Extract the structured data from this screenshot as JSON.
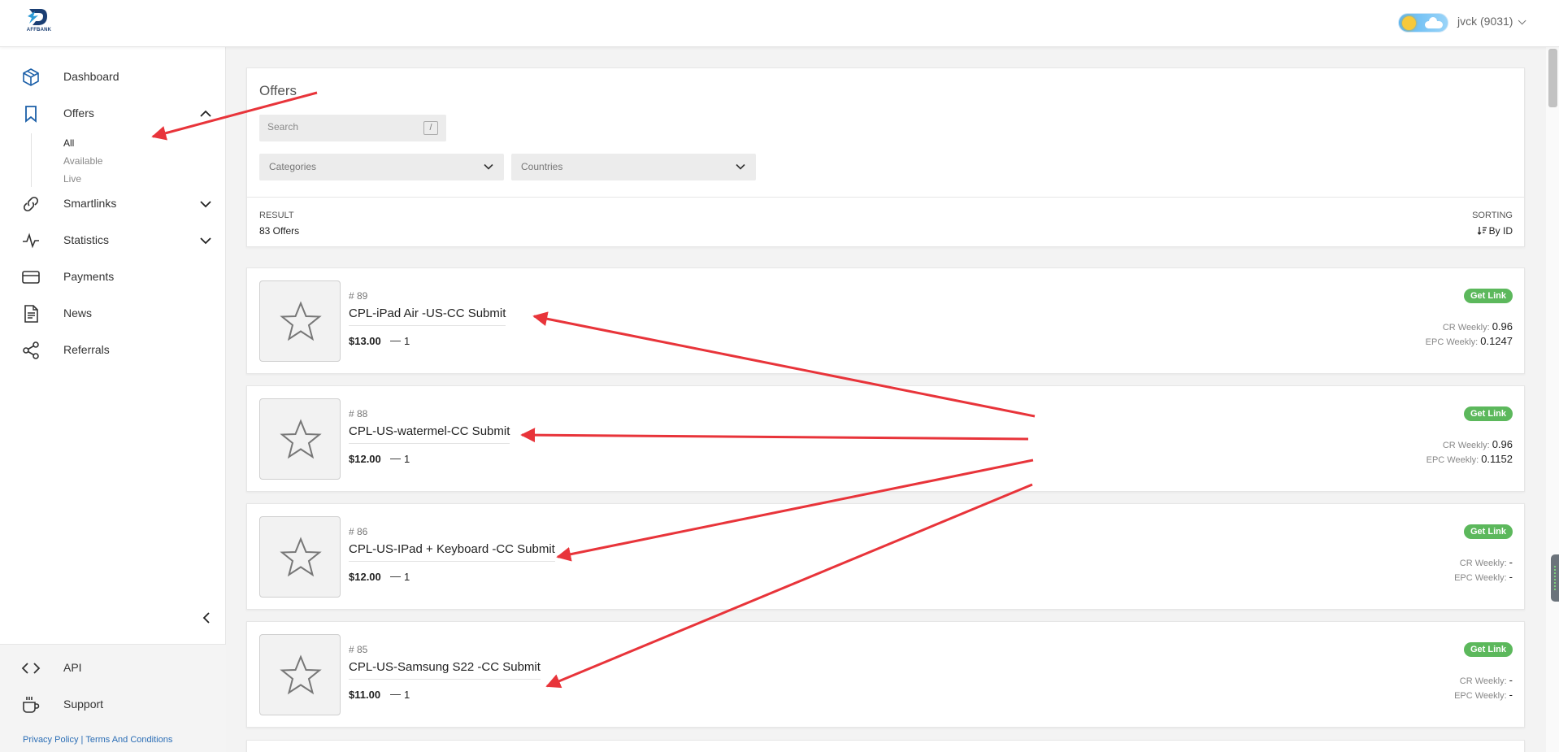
{
  "app": {
    "logo_text": "AFFBANK",
    "user_label": "jvck (9031)"
  },
  "sidebar": {
    "items": [
      {
        "label": "Dashboard",
        "icon": "cube-icon"
      },
      {
        "label": "Offers",
        "icon": "bookmark-icon"
      },
      {
        "label": "Smartlinks",
        "icon": "link-icon"
      },
      {
        "label": "Statistics",
        "icon": "pulse-icon"
      },
      {
        "label": "Payments",
        "icon": "card-icon"
      },
      {
        "label": "News",
        "icon": "document-icon"
      },
      {
        "label": "Referrals",
        "icon": "share-icon"
      }
    ],
    "offers_sub": [
      "All",
      "Available",
      "Live"
    ],
    "bottom_items": [
      {
        "label": "API",
        "icon": "code-icon"
      },
      {
        "label": "Support",
        "icon": "coffee-icon"
      }
    ],
    "footer": {
      "privacy": "Privacy Policy",
      "separator": "|",
      "terms": "Terms And Conditions"
    }
  },
  "filters": {
    "title": "Offers",
    "search_placeholder": "Search",
    "search_shortcut": "/",
    "categories": "Categories",
    "countries": "Countries",
    "result_label": "RESULT",
    "result_value": "83 Offers",
    "sorting_label": "SORTING",
    "sorting_value": "By ID"
  },
  "offers": [
    {
      "id": "# 89",
      "name": "CPL-iPad Air -US-CC Submit",
      "price": "$13.00",
      "dash": "—",
      "count": "1",
      "get_link": "Get Link",
      "cr_label": "CR Weekly:",
      "cr": "0.96",
      "epc_label": "EPC Weekly:",
      "epc": "0.1247"
    },
    {
      "id": "# 88",
      "name": "CPL-US-watermel-CC Submit",
      "price": "$12.00",
      "dash": "—",
      "count": "1",
      "get_link": "Get Link",
      "cr_label": "CR Weekly:",
      "cr": "0.96",
      "epc_label": "EPC Weekly:",
      "epc": "0.1152"
    },
    {
      "id": "# 86",
      "name": "CPL-US-IPad + Keyboard -CC Submit",
      "price": "$12.00",
      "dash": "—",
      "count": "1",
      "get_link": "Get Link",
      "cr_label": "CR Weekly:",
      "cr": "-",
      "epc_label": "EPC Weekly:",
      "epc": "-"
    },
    {
      "id": "# 85",
      "name": "CPL-US-Samsung S22 -CC Submit",
      "price": "$11.00",
      "dash": "—",
      "count": "1",
      "get_link": "Get Link",
      "cr_label": "CR Weekly:",
      "cr": "-",
      "epc_label": "EPC Weekly:",
      "epc": "-"
    }
  ],
  "colors": {
    "accent_blue": "#1b5fa8",
    "get_link_green": "#5cb85c",
    "annotation_red": "#e8343a"
  }
}
